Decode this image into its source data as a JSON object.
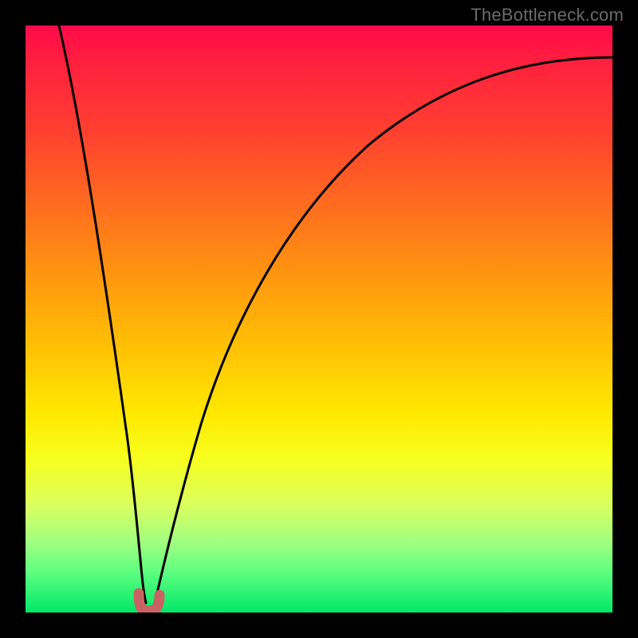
{
  "watermark": "TheBottleneck.com",
  "colors": {
    "frame": "#000000",
    "curve_stroke": "#000000",
    "accent_marker": "#c96263",
    "gradient_top": "#ff0a4a",
    "gradient_bottom": "#00e868"
  },
  "chart_data": {
    "type": "line",
    "title": "",
    "xlabel": "",
    "ylabel": "",
    "xlim": [
      0,
      100
    ],
    "ylim": [
      0,
      100
    ],
    "axes_visible": false,
    "grid": false,
    "legend": false,
    "background": "red-yellow-green vertical gradient (bottleneck severity colour scale)",
    "series": [
      {
        "name": "bottleneck-curve",
        "comment": "V-shaped curve; y≈0 is the ideal balance point near x≈20. Values estimated from pixel positions since no axes/ticks are shown.",
        "x": [
          5,
          8,
          11,
          14,
          16.5,
          18.5,
          19.8,
          20.8,
          22,
          25,
          30,
          36,
          44,
          54,
          66,
          80,
          94,
          100
        ],
        "y": [
          100,
          80,
          60,
          40,
          22,
          8,
          1.5,
          1.5,
          6,
          20,
          38,
          52,
          64,
          74,
          82,
          88,
          91.5,
          92.5
        ]
      }
    ],
    "markers": [
      {
        "name": "optimum-indicator",
        "shape": "rounded-U",
        "x": 20.3,
        "y": 1.5,
        "color": "#c96263"
      }
    ]
  }
}
